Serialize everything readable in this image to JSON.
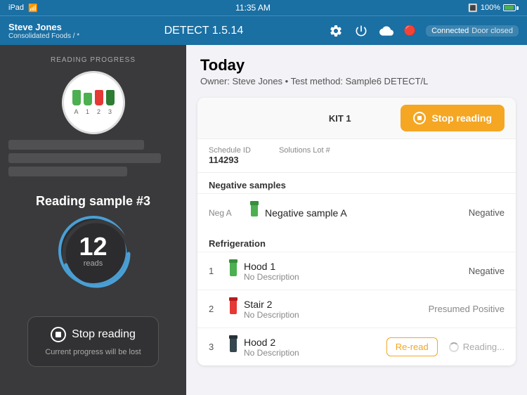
{
  "statusBar": {
    "left": "iPad",
    "time": "11:35 AM",
    "wifi": "wifi",
    "bluetooth": "bluetooth",
    "battery": "100%"
  },
  "navBar": {
    "title": "DETECT 1.5.14",
    "userName": "Steve Jones",
    "orgName": "Consolidated Foods / *",
    "settingsIcon": "gear-icon",
    "powerIcon": "power-icon",
    "cloudIcon": "cloud-icon",
    "btIcon": "bluetooth-icon",
    "connectedLabel": "Connected",
    "doorStatus": "Door closed"
  },
  "leftPanel": {
    "readingProgressLabel": "READING PROGRESS",
    "sampleLabel": "Reading sample #3",
    "readsNumber": "12",
    "readsText": "reads",
    "stopReadingLabel": "Stop reading",
    "progressWarning": "Current progress will be lost"
  },
  "rightPanel": {
    "dateLabel": "Today",
    "ownerLine": "Owner: Steve Jones • Test method: Sample6 DETECT/L",
    "kitLabel": "KIT 1",
    "scheduleIdLabel": "Schedule ID",
    "scheduleIdValue": "114293",
    "solutionsLotLabel": "Solutions Lot #",
    "solutionsLotValue": "",
    "stopReadingBtn": "Stop reading",
    "negativeSamplesSection": "Negative samples",
    "negativeRow": {
      "label": "Neg A",
      "name": "Negative sample A",
      "result": "Negative"
    },
    "refrigerationSection": "Refrigeration",
    "refrigerationRows": [
      {
        "num": "1",
        "name": "Hood 1",
        "desc": "No Description",
        "result": "Negative",
        "vialColor": "green"
      },
      {
        "num": "2",
        "name": "Stair 2",
        "desc": "No Description",
        "result": "Presumed Positive",
        "vialColor": "red"
      },
      {
        "num": "3",
        "name": "Hood 2",
        "desc": "No Description",
        "result": "Reading...",
        "vialColor": "dark",
        "reread": "Re-read"
      }
    ]
  }
}
